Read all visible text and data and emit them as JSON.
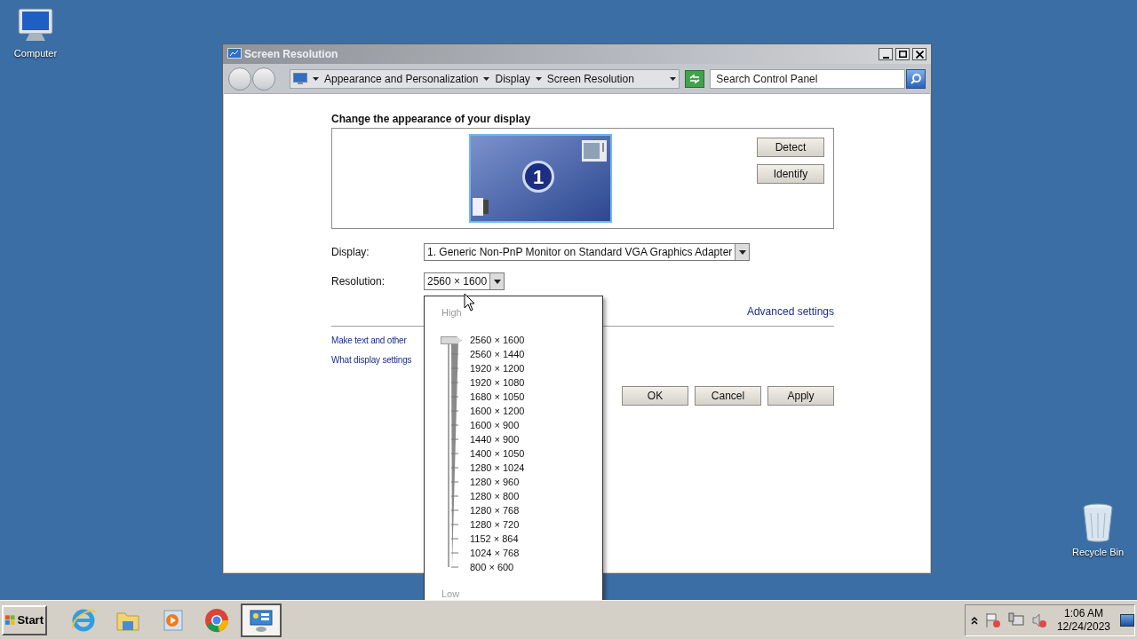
{
  "desktop_icons": [
    {
      "label": "Computer",
      "kind": "computer"
    },
    {
      "label": "Recycle Bin",
      "kind": "recycle-bin"
    }
  ],
  "window": {
    "title": "Screen Resolution"
  },
  "address_bar": {
    "breadcrumbs": [
      "Appearance and Personalization",
      "Display",
      "Screen Resolution"
    ]
  },
  "search": {
    "placeholder": "Search Control Panel"
  },
  "heading": "Change the appearance of your display",
  "monitor_preview": {
    "label": "1",
    "selected": true
  },
  "side_buttons": [
    "Detect",
    "Identify"
  ],
  "display": {
    "label": "Display:",
    "value": "1. Generic Non-PnP Monitor on Standard VGA Graphics Adapter"
  },
  "resolution": {
    "label": "Resolution:",
    "value": "2560 × 1600",
    "expanded": true,
    "popup": {
      "high_label": "High",
      "low_label": "Low",
      "level": 1,
      "options": [
        "2560 × 1600",
        "2560 × 1440",
        "1920 × 1200",
        "1920 × 1080",
        "1680 × 1050",
        "1600 × 1200",
        "1600 × 900",
        "1440 × 900",
        "1400 × 1050",
        "1280 × 1024",
        "1280 × 960",
        "1280 × 800",
        "1280 × 768",
        "1280 × 720",
        "1152 × 864",
        "1024 × 768",
        "800 × 600"
      ]
    }
  },
  "advanced_link": "Advanced settings",
  "links": [
    "Make text and other",
    "What display settings"
  ],
  "buttons": [
    "OK",
    "Cancel",
    "Apply"
  ],
  "taskbar": {
    "start": "Start",
    "apps": [
      {
        "kind": "browser-e",
        "selected": false
      },
      {
        "kind": "folder",
        "selected": false
      },
      {
        "kind": "media",
        "selected": false
      },
      {
        "kind": "chrome",
        "selected": false
      },
      {
        "kind": "control-panel",
        "selected": true
      }
    ]
  },
  "tray": {
    "time": "1:06 AM",
    "date": "12/24/2023"
  }
}
